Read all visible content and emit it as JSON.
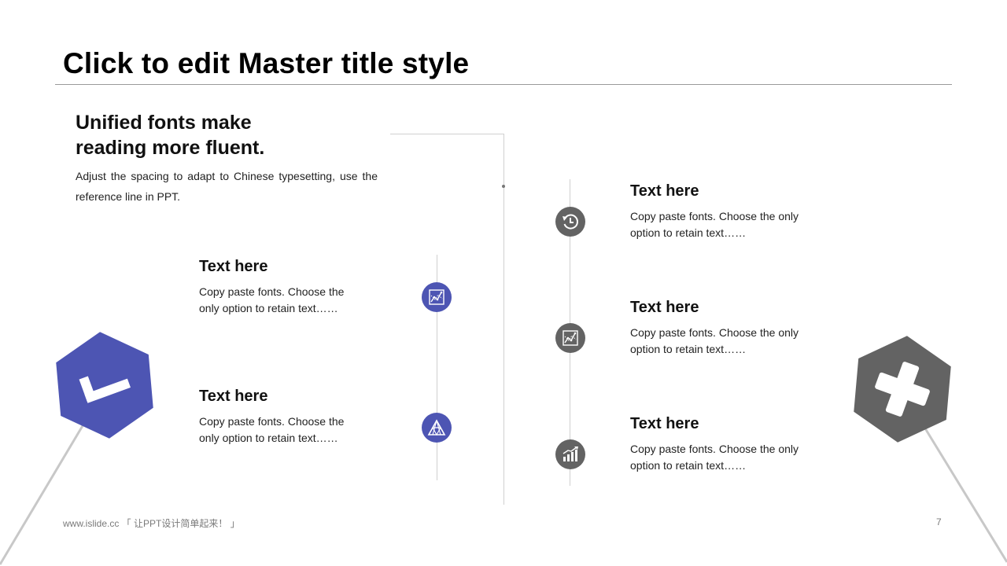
{
  "slide": {
    "title": "Click to edit Master title style",
    "page_number": "7",
    "footer": "www.islide.cc 「 让PPT设计简单起来！ 」"
  },
  "intro": {
    "heading_line1": "Unified fonts make",
    "heading_line2": "reading more fluent.",
    "body": "Adjust the spacing to adapt to Chinese typesetting, use the reference line in PPT."
  },
  "left_items": [
    {
      "title": "Text here",
      "text": "Copy paste fonts. Choose the only option to retain text……",
      "icon": "line-chart-icon"
    },
    {
      "title": "Text here",
      "text": "Copy paste fonts. Choose the only option to retain text……",
      "icon": "triangle-network-icon"
    }
  ],
  "right_items": [
    {
      "title": "Text here",
      "text": "Copy paste fonts. Choose the only option to retain text……",
      "icon": "history-clock-icon"
    },
    {
      "title": "Text here",
      "text": "Copy paste fonts. Choose the only option to retain text……",
      "icon": "line-chart-icon"
    },
    {
      "title": "Text here",
      "text": "Copy paste fonts. Choose the only option to retain text……",
      "icon": "bar-chart-growth-icon"
    }
  ],
  "decor": {
    "left_hexagon_icon": "check-icon",
    "right_hexagon_icon": "cross-icon"
  },
  "colors": {
    "accent_blue": "#4d55b3",
    "accent_gray": "#636363",
    "rule": "#9a9a9a"
  }
}
